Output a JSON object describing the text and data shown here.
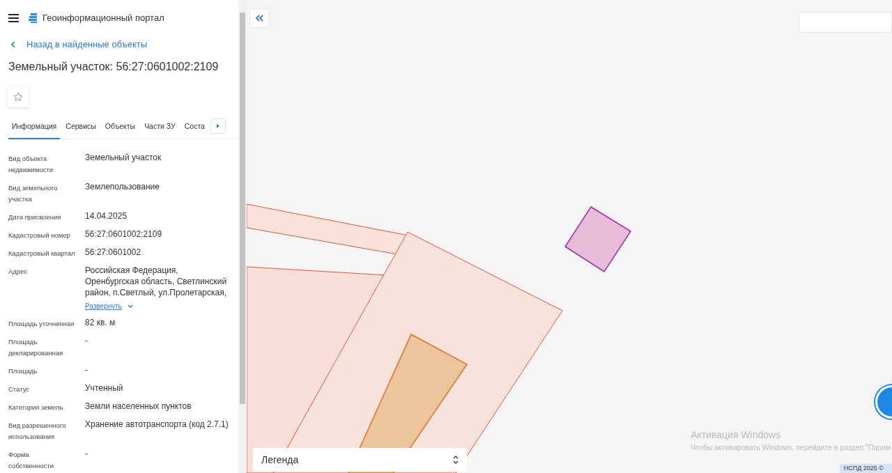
{
  "header": {
    "title": "Геоинформационный портал"
  },
  "back_link": "Назад в найденные объекты",
  "object_title": "Земельный участок: 56:27:0601002:2109",
  "favorite": {
    "selected": false
  },
  "tabs": [
    {
      "label": "Информация",
      "selected": true
    },
    {
      "label": "Сервисы",
      "selected": false
    },
    {
      "label": "Объекты",
      "selected": false
    },
    {
      "label": "Части ЗУ",
      "selected": false
    },
    {
      "label": "Соста",
      "selected": false
    }
  ],
  "details": [
    {
      "kind": "plain",
      "label": "Вид объекта недвижимости",
      "value": "Земельный участок"
    },
    {
      "kind": "plain",
      "label": "Вид земельного участка",
      "value": "Землепользование"
    },
    {
      "kind": "plain",
      "label": "Дата присвоения",
      "value": "14.04.2025"
    },
    {
      "kind": "plain",
      "label": "Кадастровый номер",
      "value": "56:27:0601002:2109"
    },
    {
      "kind": "plain",
      "label": "Кадастровый квартал",
      "value": "56:27:0601002"
    },
    {
      "kind": "expandable",
      "label": "Адрес",
      "value": "Российская Федерация, Оренбургская область, Светлинский район, п.Светлый, ул.Пролетарская,",
      "expand_link": "Развернуть"
    },
    {
      "kind": "plain",
      "label": "Площадь уточненная",
      "value": "82 кв. м"
    },
    {
      "kind": "plain",
      "label": "Площадь декларированная",
      "value": "-"
    },
    {
      "kind": "plain",
      "label": "Площадь",
      "value": "-"
    },
    {
      "kind": "plain",
      "label": "Статус",
      "value": "Учтенный"
    },
    {
      "kind": "plain",
      "label": "Категория земель",
      "value": "Земли населенных пунктов"
    },
    {
      "kind": "plain",
      "label": "Вид разрешенного использования",
      "value": "Хранение автотранспорта (код 2.7.1)"
    },
    {
      "kind": "plain",
      "label": "Форма собственности",
      "value": "-"
    }
  ],
  "map": {
    "legend": "Легенда",
    "attribution": "НСПД 2025 ©"
  },
  "os_notice": {
    "title": "Активация Windows",
    "text": "Чтобы активировать Windows, перейдите в раздел \"Парам"
  }
}
